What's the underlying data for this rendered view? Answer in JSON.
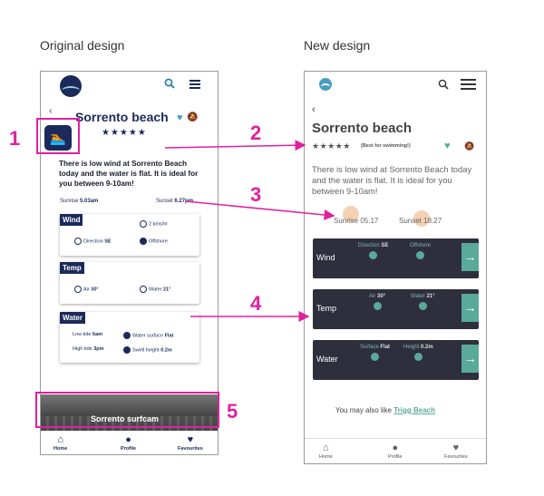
{
  "captions": {
    "original": "Original design",
    "new": "New design"
  },
  "annotations": [
    "1",
    "2",
    "3",
    "4",
    "5"
  ],
  "colors": {
    "annotation": "#e0219e",
    "navy": "#1b2a5a",
    "teal": "#5aaa9a",
    "tile_bg": "#2e2f3d"
  },
  "original": {
    "title": "Sorrento beach",
    "stars": "★★★★★",
    "back": "‹",
    "description": "There is low wind at Sorrento Beach today and the water is flat. It is ideal for you between 9-10am!",
    "sunrise_label": "Sunrise",
    "sunrise_time": "5.03am",
    "sunset_label": "Sunset",
    "sunset_time": "6.27pm",
    "wind": {
      "header": "Wind",
      "speed": "2 kms/hr",
      "direction_label": "Direction",
      "direction": "SE",
      "offshore": "Offshore"
    },
    "temp": {
      "header": "Temp",
      "air_label": "Air",
      "air": "30°",
      "water_label": "Water",
      "water": "21°"
    },
    "water": {
      "header": "Water",
      "low_tide_label": "Low tide",
      "low_tide": "6am",
      "surface_label": "Water surface",
      "surface": "Flat",
      "high_tide_label": "High tide",
      "high_tide": "3pm",
      "swell_label": "Swell height",
      "swell": "0.2m"
    },
    "surfcam": "Sorrento surfcam",
    "nav": [
      "Home",
      "Profile",
      "Favourites"
    ]
  },
  "new": {
    "title": "Sorrento beach",
    "stars": "★★★★★",
    "best": "(Best for swimming!)",
    "back": "‹",
    "description": "There is low wind at Sorrento Beach today and the water is flat. It is ideal for you between 9-10am!",
    "sunrise": "Sunrise 05.17",
    "sunset": "Sunset 18.27",
    "tiles": [
      {
        "name": "Wind",
        "m1_label": "Direction",
        "m1_value": "SE",
        "m2_label": "Offshore",
        "m2_value": ""
      },
      {
        "name": "Temp",
        "m1_label": "Air",
        "m1_value": "30°",
        "m2_label": "Water",
        "m2_value": "21°"
      },
      {
        "name": "Water",
        "m1_label": "Surface",
        "m1_value": "Flat",
        "m2_label": "Height",
        "m2_value": "0.2m"
      }
    ],
    "also_text": "You may also like",
    "also_link": "Trigg Beach",
    "nav": [
      "Home",
      "Profile",
      "Favourites"
    ]
  }
}
